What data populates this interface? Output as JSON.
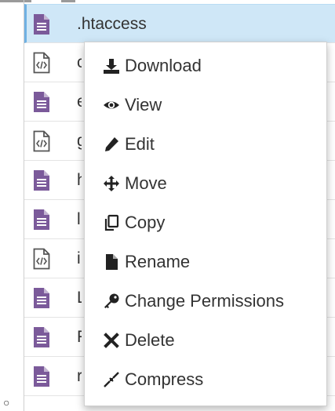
{
  "files": [
    {
      "name": ".htaccess",
      "type": "text",
      "selected": true
    },
    {
      "name": "c",
      "type": "code",
      "selected": false
    },
    {
      "name": "e",
      "type": "text",
      "selected": false
    },
    {
      "name": "g",
      "type": "code",
      "selected": false
    },
    {
      "name": "h",
      "type": "text",
      "selected": false
    },
    {
      "name": "l",
      "type": "text",
      "selected": false
    },
    {
      "name": "i",
      "type": "code",
      "selected": false
    },
    {
      "name": "L",
      "type": "text",
      "selected": false
    },
    {
      "name": "F",
      "type": "text",
      "selected": false
    },
    {
      "name": "r",
      "type": "text",
      "selected": false
    }
  ],
  "context_menu": {
    "items": [
      {
        "id": "download",
        "label": "Download",
        "icon": "download-icon"
      },
      {
        "id": "view",
        "label": "View",
        "icon": "eye-icon"
      },
      {
        "id": "edit",
        "label": "Edit",
        "icon": "pencil-icon"
      },
      {
        "id": "move",
        "label": "Move",
        "icon": "move-arrows-icon"
      },
      {
        "id": "copy",
        "label": "Copy",
        "icon": "copy-icon"
      },
      {
        "id": "rename",
        "label": "Rename",
        "icon": "file-icon"
      },
      {
        "id": "change-permissions",
        "label": "Change Permissions",
        "icon": "key-icon"
      },
      {
        "id": "delete",
        "label": "Delete",
        "icon": "times-icon"
      },
      {
        "id": "compress",
        "label": "Compress",
        "icon": "compress-icon"
      }
    ]
  },
  "colors": {
    "text_file_icon": "#7b5a9a",
    "code_file_icon": "#555555",
    "selected_row": "#cfe7f7",
    "selected_border": "#6fb1e3"
  }
}
